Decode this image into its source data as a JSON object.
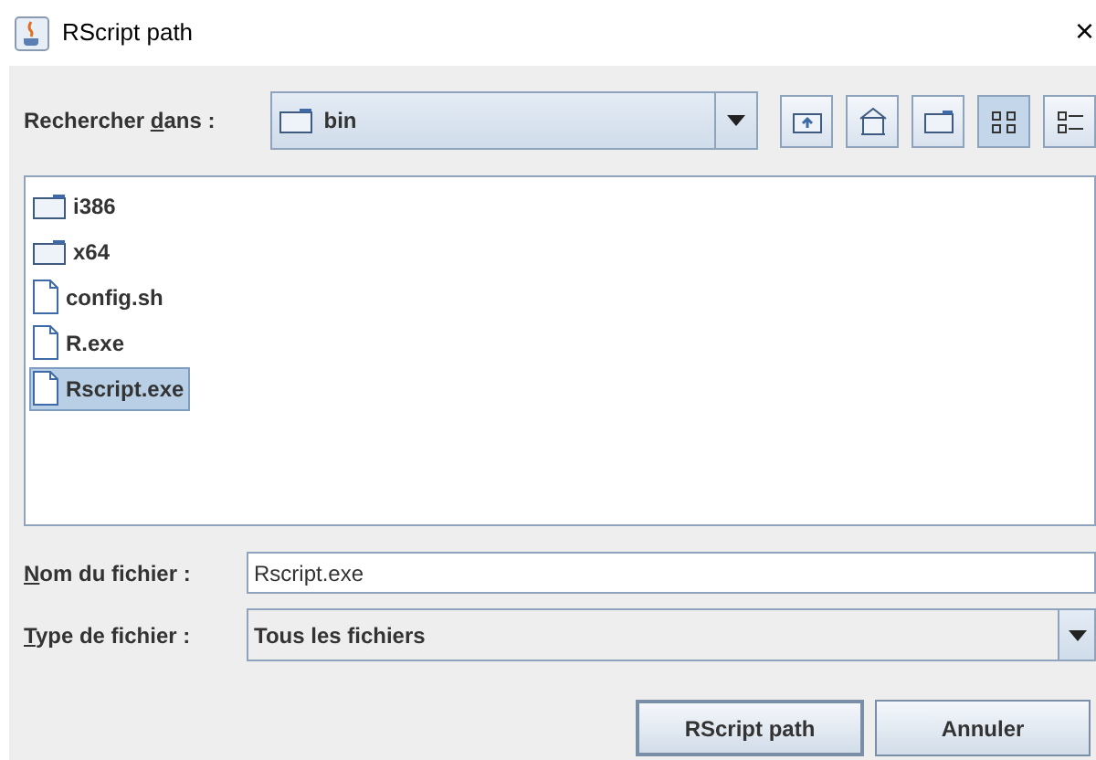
{
  "window": {
    "title": "RScript path",
    "close": "×"
  },
  "look_in": {
    "label_parts": [
      {
        "text": "Rechercher ",
        "underlined": false
      },
      {
        "text": "d",
        "underlined": true
      },
      {
        "text": "ans :",
        "underlined": false
      }
    ],
    "value": "bin"
  },
  "toolbar": [
    {
      "kind": "up-folder",
      "selected": false
    },
    {
      "kind": "home",
      "selected": false
    },
    {
      "kind": "new-folder",
      "selected": false
    },
    {
      "kind": "list-view",
      "selected": true
    },
    {
      "kind": "details-view",
      "selected": false
    }
  ],
  "files": [
    {
      "name": "i386",
      "kind": "folder",
      "selected": false
    },
    {
      "name": "x64",
      "kind": "folder",
      "selected": false
    },
    {
      "name": "config.sh",
      "kind": "file",
      "selected": false
    },
    {
      "name": "R.exe",
      "kind": "file",
      "selected": false
    },
    {
      "name": "Rscript.exe",
      "kind": "file",
      "selected": true
    }
  ],
  "file_name": {
    "label_parts": [
      {
        "text": "N",
        "underlined": true
      },
      {
        "text": "om du fichier :",
        "underlined": false
      }
    ],
    "value": "Rscript.exe"
  },
  "file_type": {
    "label_parts": [
      {
        "text": "T",
        "underlined": true
      },
      {
        "text": "ype de fichier :",
        "underlined": false
      }
    ],
    "value": "Tous les fichiers"
  },
  "buttons": [
    "RScript path",
    "Annuler"
  ]
}
